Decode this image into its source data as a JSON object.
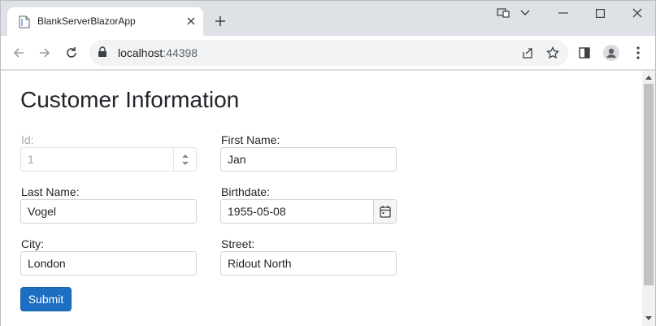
{
  "browser": {
    "tab_title": "BlankServerBlazorApp",
    "url_host": "localhost",
    "url_port": ":44398"
  },
  "page": {
    "title": "Customer Information"
  },
  "form": {
    "id": {
      "label": "Id:",
      "value": "1"
    },
    "first_name": {
      "label": "First Name:",
      "value": "Jan"
    },
    "last_name": {
      "label": "Last Name:",
      "value": "Vogel"
    },
    "birthdate": {
      "label": "Birthdate:",
      "value": "1955-05-08"
    },
    "city": {
      "label": "City:",
      "value": "London"
    },
    "street": {
      "label": "Street:",
      "value": "Ridout North"
    },
    "submit_label": "Submit"
  },
  "colors": {
    "primary_button": "#1b6ec2",
    "tab_strip": "#dee1e6"
  }
}
